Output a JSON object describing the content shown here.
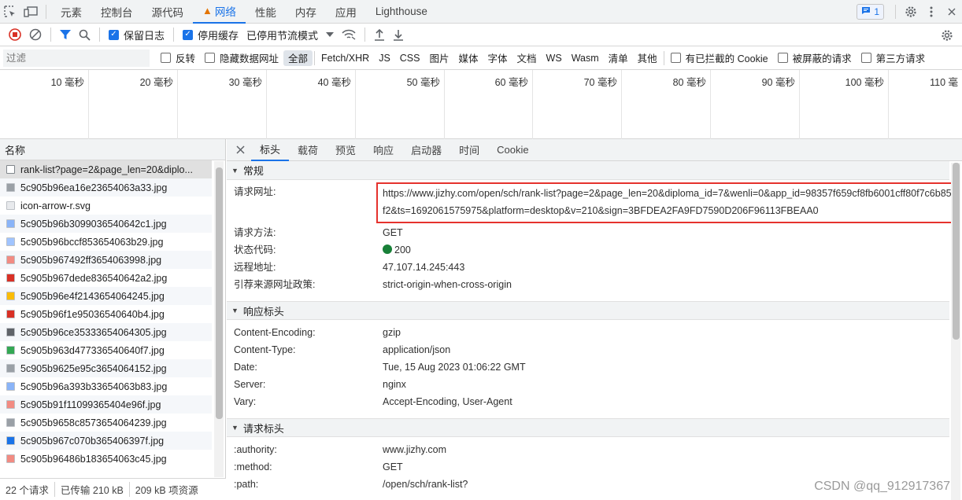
{
  "tabs": {
    "items": [
      "元素",
      "控制台",
      "源代码",
      "网络",
      "性能",
      "内存",
      "应用",
      "Lighthouse"
    ],
    "issues_count": "1"
  },
  "toolbar": {
    "preserve_log": "保留日志",
    "disable_cache": "停用缓存",
    "throttling": "已停用节流模式"
  },
  "filter": {
    "placeholder": "过滤",
    "invert": "反转",
    "hide_data_urls": "隐藏数据网址",
    "types": [
      "全部",
      "Fetch/XHR",
      "JS",
      "CSS",
      "图片",
      "媒体",
      "字体",
      "文档",
      "WS",
      "Wasm",
      "清单",
      "其他"
    ],
    "blocked_cookies": "有已拦截的 Cookie",
    "blocked_requests": "被屏蔽的请求",
    "third_party": "第三方请求"
  },
  "timeline": {
    "ticks": [
      "10 毫秒",
      "20 毫秒",
      "30 毫秒",
      "40 毫秒",
      "50 毫秒",
      "60 毫秒",
      "70 毫秒",
      "80 毫秒",
      "90 毫秒",
      "100 毫秒",
      "110 毫"
    ]
  },
  "requests": {
    "header": "名称",
    "items": [
      "rank-list?page=2&page_len=20&diplo...",
      "5c905b96ea16e23654063a33.jpg",
      "icon-arrow-r.svg",
      "5c905b96b3099036540642c1.jpg",
      "5c905b96bccf853654063b29.jpg",
      "5c905b967492ff3654063998.jpg",
      "5c905b967dede836540642a2.jpg",
      "5c905b96e4f2143654064245.jpg",
      "5c905b96f1e95036540640b4.jpg",
      "5c905b96ce35333654064305.jpg",
      "5c905b963d477336540640f7.jpg",
      "5c905b9625e95c3654064152.jpg",
      "5c905b96a393b33654063b83.jpg",
      "5c905b91f11099365404e96f.jpg",
      "5c905b9658c8573654064239.jpg",
      "5c905b967c070b365406397f.jpg",
      "5c905b96486b183654063c45.jpg"
    ],
    "icon_colors": [
      "#ffffff",
      "#9aa0a6",
      "#e8eaed",
      "#8ab4f8",
      "#a0c4ff",
      "#f28b82",
      "#d93025",
      "#fbbc04",
      "#d93025",
      "#5f6368",
      "#34a853",
      "#9aa0a6",
      "#8ab4f8",
      "#f28b82",
      "#9aa0a6",
      "#1a73e8",
      "#f28b82"
    ]
  },
  "status": {
    "requests": "22 个请求",
    "transferred": "已传输 210 kB",
    "resources": "209 kB 项资源"
  },
  "detail": {
    "tabs": [
      "标头",
      "载荷",
      "预览",
      "响应",
      "启动器",
      "时间",
      "Cookie"
    ],
    "general": {
      "title": "常规",
      "url_label": "请求网址:",
      "url": "https://www.jizhy.com/open/sch/rank-list?page=2&page_len=20&diploma_id=7&wenli=0&app_id=98357f659cf8fb6001cff80f7c6b85f2&ts=1692061575975&platform=desktop&v=210&sign=3BFDEA2FA9FD7590D206F96113FBEAA0",
      "rows": [
        {
          "k": "请求方法:",
          "v": "GET"
        },
        {
          "k": "状态代码:",
          "v": "200"
        },
        {
          "k": "远程地址:",
          "v": "47.107.14.245:443"
        },
        {
          "k": "引荐来源网址政策:",
          "v": "strict-origin-when-cross-origin"
        }
      ]
    },
    "response": {
      "title": "响应标头",
      "rows": [
        {
          "k": "Content-Encoding:",
          "v": "gzip"
        },
        {
          "k": "Content-Type:",
          "v": "application/json"
        },
        {
          "k": "Date:",
          "v": "Tue, 15 Aug 2023 01:06:22 GMT"
        },
        {
          "k": "Server:",
          "v": "nginx"
        },
        {
          "k": "Vary:",
          "v": "Accept-Encoding, User-Agent"
        }
      ]
    },
    "request": {
      "title": "请求标头",
      "rows": [
        {
          "k": ":authority:",
          "v": "www.jizhy.com"
        },
        {
          "k": ":method:",
          "v": "GET"
        },
        {
          "k": ":path:",
          "v": "/open/sch/rank-list?"
        }
      ]
    }
  },
  "watermark": "CSDN @qq_912917367",
  "colors": {
    "accent": "#1a73e8",
    "highlight_box": "#e5322d",
    "status_ok": "#188038"
  }
}
